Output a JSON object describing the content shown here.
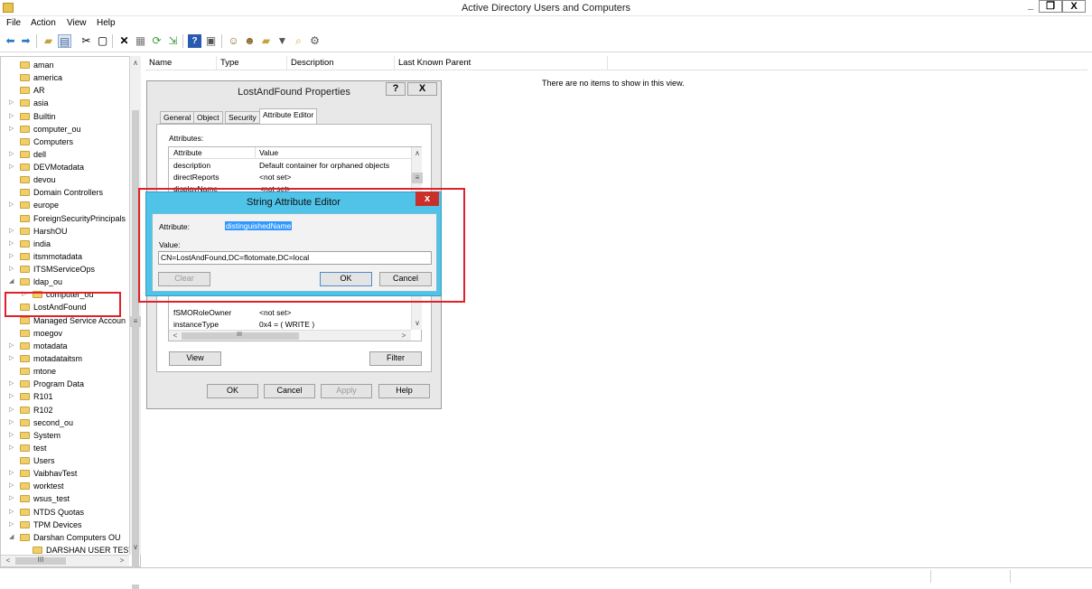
{
  "window": {
    "title": "Active Directory Users and Computers",
    "min_glyph": "_",
    "max_glyph": "❐",
    "close_glyph": "X"
  },
  "menu": [
    "File",
    "Action",
    "View",
    "Help"
  ],
  "toolbar": {
    "icons": [
      "back-arrow-icon",
      "forward-arrow-icon",
      "up-folder-icon",
      "show-tree-icon",
      "cut-icon",
      "copy-icon",
      "delete-icon",
      "properties-icon",
      "refresh-icon",
      "export-icon",
      "help-icon",
      "console-icon",
      "users-icon",
      "groups-icon",
      "new-ou-icon",
      "filter-icon",
      "find-icon"
    ]
  },
  "tree": [
    {
      "label": "aman",
      "expandable": false
    },
    {
      "label": "america",
      "expandable": false
    },
    {
      "label": "AR",
      "expandable": false
    },
    {
      "label": "asia",
      "expandable": true
    },
    {
      "label": "Builtin",
      "expandable": true
    },
    {
      "label": "computer_ou",
      "expandable": true
    },
    {
      "label": "Computers",
      "expandable": false
    },
    {
      "label": "dell",
      "expandable": true
    },
    {
      "label": "DEVMotadata",
      "expandable": true
    },
    {
      "label": "devou",
      "expandable": false
    },
    {
      "label": "Domain Controllers",
      "expandable": false
    },
    {
      "label": "europe",
      "expandable": true
    },
    {
      "label": "ForeignSecurityPrincipals",
      "expandable": false
    },
    {
      "label": "HarshOU",
      "expandable": true
    },
    {
      "label": "india",
      "expandable": true
    },
    {
      "label": "itsmmotadata",
      "expandable": true
    },
    {
      "label": "ITSMServiceOps",
      "expandable": true
    },
    {
      "label": "ldap_ou",
      "expandable": true
    },
    {
      "label": "computer_ou",
      "expandable": true,
      "indent": true
    },
    {
      "label": "LostAndFound",
      "expandable": false
    },
    {
      "label": "Managed Service Accoun",
      "expandable": false
    },
    {
      "label": "moegov",
      "expandable": false
    },
    {
      "label": "motadata",
      "expandable": true
    },
    {
      "label": "motadataitsm",
      "expandable": true
    },
    {
      "label": "mtone",
      "expandable": false
    },
    {
      "label": "Program Data",
      "expandable": true
    },
    {
      "label": "R101",
      "expandable": true
    },
    {
      "label": "R102",
      "expandable": true
    },
    {
      "label": "second_ou",
      "expandable": true
    },
    {
      "label": "System",
      "expandable": true
    },
    {
      "label": "test",
      "expandable": true
    },
    {
      "label": "Users",
      "expandable": false
    },
    {
      "label": "VaibhavTest",
      "expandable": true
    },
    {
      "label": "worktest",
      "expandable": true
    },
    {
      "label": "wsus_test",
      "expandable": true
    },
    {
      "label": "NTDS Quotas",
      "expandable": true
    },
    {
      "label": "TPM Devices",
      "expandable": true
    },
    {
      "label": "Darshan Computers OU",
      "expandable": true
    },
    {
      "label": "DARSHAN USER TEST",
      "expandable": false,
      "indent": true
    }
  ],
  "list": {
    "columns": [
      "Name",
      "Type",
      "Description",
      "Last Known Parent"
    ],
    "empty_text": "There are no items to show in this view."
  },
  "properties_dialog": {
    "title": "LostAndFound Properties",
    "help_glyph": "?",
    "close_glyph": "X",
    "tabs": [
      "General",
      "Object",
      "Security",
      "Attribute Editor"
    ],
    "attributes_label": "Attributes:",
    "col_attribute": "Attribute",
    "col_value": "Value",
    "rows_top": [
      {
        "attr": "description",
        "value": "Default container for orphaned objects"
      },
      {
        "attr": "directReports",
        "value": "<not set>"
      },
      {
        "attr": "displayName",
        "value": "<not set>"
      }
    ],
    "rows_bottom": [
      {
        "attr": "fSMORoleOwner",
        "value": "<not set>"
      },
      {
        "attr": "instanceType",
        "value": "0x4 = ( WRITE )"
      }
    ],
    "hscroll_glyph": "III",
    "view_button": "View",
    "filter_button": "Filter",
    "ok_button": "OK",
    "cancel_button": "Cancel",
    "apply_button": "Apply",
    "help_button": "Help"
  },
  "string_editor": {
    "title": "String Attribute Editor",
    "attribute_label": "Attribute:",
    "attribute_value": "distinguishedName",
    "value_label": "Value:",
    "value": "CN=LostAndFound,DC=flotomate,DC=local",
    "clear_button": "Clear",
    "ok_button": "OK",
    "cancel_button": "Cancel",
    "close_glyph": "x"
  }
}
